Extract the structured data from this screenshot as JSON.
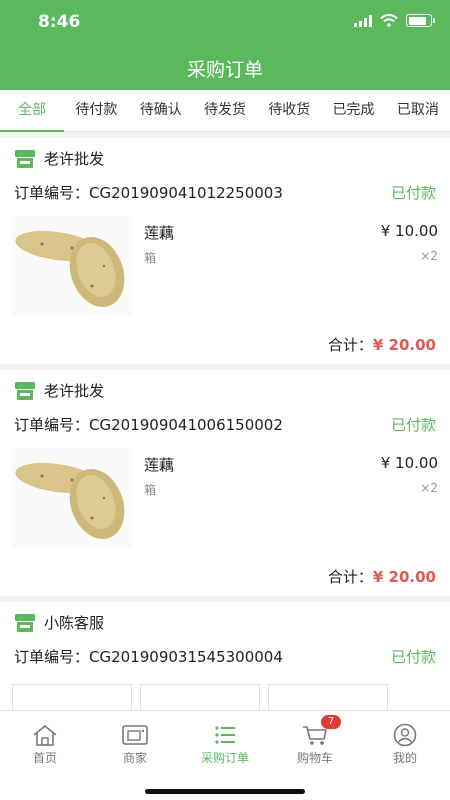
{
  "status_bar": {
    "time": "8:46",
    "battery_level": 0.85
  },
  "header": {
    "title": "采购订单"
  },
  "tabs": [
    {
      "label": "全部",
      "active": true
    },
    {
      "label": "待付款",
      "active": false
    },
    {
      "label": "待确认",
      "active": false
    },
    {
      "label": "待发货",
      "active": false
    },
    {
      "label": "待收货",
      "active": false
    },
    {
      "label": "已完成",
      "active": false
    },
    {
      "label": "已取消",
      "active": false
    }
  ],
  "orders": [
    {
      "store": "老许批发",
      "order_no_label": "订单编号：",
      "order_no": "CG201909041012250003",
      "status": "已付款",
      "product": {
        "name": "莲藕",
        "unit": "箱",
        "price": "¥ 10.00",
        "qty": "×2"
      },
      "total_label": "合计：",
      "total": "¥ 20.00"
    },
    {
      "store": "老许批发",
      "order_no_label": "订单编号：",
      "order_no": "CG201909041006150002",
      "status": "已付款",
      "product": {
        "name": "莲藕",
        "unit": "箱",
        "price": "¥ 10.00",
        "qty": "×2"
      },
      "total_label": "合计：",
      "total": "¥ 20.00"
    },
    {
      "store": "小陈客服",
      "order_no_label": "订单编号：",
      "order_no": "CG201909031545300004",
      "status": "已付款"
    }
  ],
  "bottom_nav": [
    {
      "label": "首页",
      "icon": "home-icon",
      "active": false
    },
    {
      "label": "商家",
      "icon": "store-icon",
      "active": false
    },
    {
      "label": "采购订单",
      "icon": "list-icon",
      "active": true
    },
    {
      "label": "购物车",
      "icon": "cart-icon",
      "active": false,
      "badge": "7"
    },
    {
      "label": "我的",
      "icon": "user-icon",
      "active": false
    }
  ],
  "colors": {
    "brand": "#5cb85c",
    "price": "#e05a4f",
    "badge": "#e53935"
  }
}
